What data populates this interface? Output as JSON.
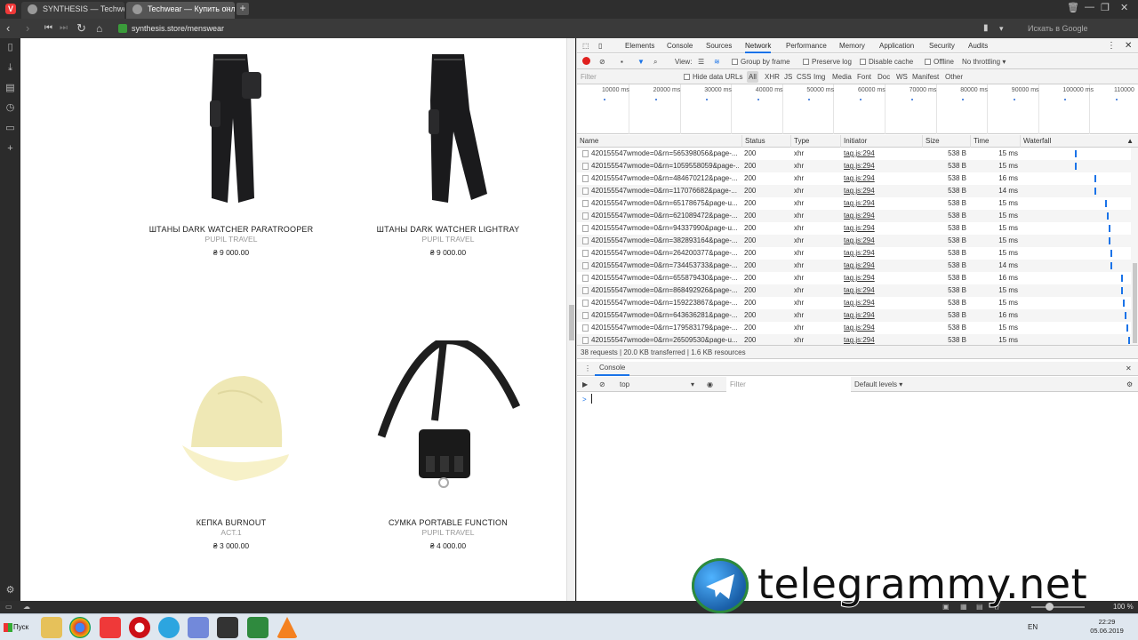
{
  "browser": {
    "tabs": [
      {
        "title": "SYNTHESIS — Techwear, м"
      },
      {
        "title": "Techwear — Купить онлай"
      }
    ],
    "url": "synthesis.store/menswear",
    "search_placeholder": "Искать в Google"
  },
  "products": [
    {
      "name": "ШТАНЫ DARK WATCHER PARATROOPER",
      "brand": "PUPIL TRAVEL",
      "price": "₴ 9 000.00"
    },
    {
      "name": "ШТАНЫ DARK WATCHER LIGHTRAY",
      "brand": "PUPIL TRAVEL",
      "price": "₴ 9 000.00"
    },
    {
      "name": "КЕПКА BURNOUT",
      "brand": "ACT.1",
      "price": "₴ 3 000.00"
    },
    {
      "name": "СУМКА PORTABLE FUNCTION",
      "brand": "PUPIL TRAVEL",
      "price": "₴ 4 000.00"
    }
  ],
  "devtools": {
    "tabs": [
      "Elements",
      "Console",
      "Sources",
      "Network",
      "Performance",
      "Memory",
      "Application",
      "Security",
      "Audits"
    ],
    "active_tab": "Network",
    "toolbar": {
      "view_label": "View:",
      "group_by_frame": "Group by frame",
      "preserve_log": "Preserve log",
      "disable_cache": "Disable cache",
      "offline": "Offline",
      "throttling": "No throttling"
    },
    "filter_placeholder": "Filter",
    "hide_data_urls": "Hide data URLs",
    "type_filters": [
      "All",
      "XHR",
      "JS",
      "CSS",
      "Img",
      "Media",
      "Font",
      "Doc",
      "WS",
      "Manifest",
      "Other"
    ],
    "overview_ticks": [
      "10000 ms",
      "20000 ms",
      "30000 ms",
      "40000 ms",
      "50000 ms",
      "60000 ms",
      "70000 ms",
      "80000 ms",
      "90000 ms",
      "100000 ms",
      "110000"
    ],
    "columns": [
      "Name",
      "Status",
      "Type",
      "Initiator",
      "Size",
      "Time",
      "Waterfall"
    ],
    "rows": [
      {
        "name": "420155547wmode=0&rn=565398056&page-...",
        "status": "200",
        "type": "xhr",
        "initiator": "tag.js:294",
        "size": "538 B",
        "time": "15 ms"
      },
      {
        "name": "420155547wmode=0&rn=1059558059&page-...",
        "status": "200",
        "type": "xhr",
        "initiator": "tag.js:294",
        "size": "538 B",
        "time": "15 ms"
      },
      {
        "name": "420155547wmode=0&rn=484670212&page-...",
        "status": "200",
        "type": "xhr",
        "initiator": "tag.js:294",
        "size": "538 B",
        "time": "16 ms"
      },
      {
        "name": "420155547wmode=0&rn=117076682&page-...",
        "status": "200",
        "type": "xhr",
        "initiator": "tag.js:294",
        "size": "538 B",
        "time": "14 ms"
      },
      {
        "name": "420155547wmode=0&rn=65178675&page-u...",
        "status": "200",
        "type": "xhr",
        "initiator": "tag.js:294",
        "size": "538 B",
        "time": "15 ms"
      },
      {
        "name": "420155547wmode=0&rn=621089472&page-...",
        "status": "200",
        "type": "xhr",
        "initiator": "tag.js:294",
        "size": "538 B",
        "time": "15 ms"
      },
      {
        "name": "420155547wmode=0&rn=94337990&page-u...",
        "status": "200",
        "type": "xhr",
        "initiator": "tag.js:294",
        "size": "538 B",
        "time": "15 ms"
      },
      {
        "name": "420155547wmode=0&rn=382893164&page-...",
        "status": "200",
        "type": "xhr",
        "initiator": "tag.js:294",
        "size": "538 B",
        "time": "15 ms"
      },
      {
        "name": "420155547wmode=0&rn=264200377&page-...",
        "status": "200",
        "type": "xhr",
        "initiator": "tag.js:294",
        "size": "538 B",
        "time": "15 ms"
      },
      {
        "name": "420155547wmode=0&rn=734453733&page-...",
        "status": "200",
        "type": "xhr",
        "initiator": "tag.js:294",
        "size": "538 B",
        "time": "14 ms"
      },
      {
        "name": "420155547wmode=0&rn=655879430&page-...",
        "status": "200",
        "type": "xhr",
        "initiator": "tag.js:294",
        "size": "538 B",
        "time": "16 ms"
      },
      {
        "name": "420155547wmode=0&rn=868492926&page-...",
        "status": "200",
        "type": "xhr",
        "initiator": "tag.js:294",
        "size": "538 B",
        "time": "15 ms"
      },
      {
        "name": "420155547wmode=0&rn=159223867&page-...",
        "status": "200",
        "type": "xhr",
        "initiator": "tag.js:294",
        "size": "538 B",
        "time": "15 ms"
      },
      {
        "name": "420155547wmode=0&rn=643636281&page-...",
        "status": "200",
        "type": "xhr",
        "initiator": "tag.js:294",
        "size": "538 B",
        "time": "16 ms"
      },
      {
        "name": "420155547wmode=0&rn=179583179&page-...",
        "status": "200",
        "type": "xhr",
        "initiator": "tag.js:294",
        "size": "538 B",
        "time": "15 ms"
      },
      {
        "name": "420155547wmode=0&rn=26509530&page-u...",
        "status": "200",
        "type": "xhr",
        "initiator": "tag.js:294",
        "size": "538 B",
        "time": "15 ms"
      }
    ],
    "summary": "38 requests  |  20.0 KB transferred  |  1.6 KB resources",
    "console": {
      "tab_label": "Console",
      "context": "top",
      "filter_placeholder": "Filter",
      "levels": "Default levels ▾",
      "prompt": ">"
    }
  },
  "statusbar": {
    "zoom": "100 %"
  },
  "taskbar": {
    "start_label": "Пуск",
    "lang": "EN",
    "time": "22:29",
    "date": "05.06.2019"
  },
  "watermark": "telegrammy.net"
}
